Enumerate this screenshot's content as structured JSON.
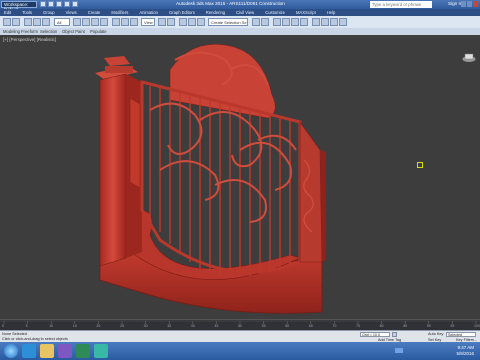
{
  "titlebar": {
    "workspace": "Workspace: Default",
    "title": "Autodesk 3ds Max 2015 - ARS111/D061 Construction",
    "search_placeholder": "Type a keyword or phrase",
    "signin": "Sign In"
  },
  "menu": [
    "Edit",
    "Tools",
    "Group",
    "Views",
    "Create",
    "Modifiers",
    "Animation",
    "Graph Editors",
    "Rendering",
    "Civil View",
    "Customize",
    "MAXScript",
    "Help"
  ],
  "toolbar": {
    "filter_value": "All",
    "view_value": "View",
    "selection_set_value": "Create Selection Se"
  },
  "ribbon": {
    "items": [
      "Modeling",
      "Freeform",
      "Selection",
      "Object Paint",
      "Populate"
    ]
  },
  "viewport": {
    "label": "[+] [Perspective] [Realistic]"
  },
  "timeline": {
    "ticks": [
      "0",
      "5",
      "10",
      "15",
      "20",
      "25",
      "30",
      "35",
      "40",
      "45",
      "50",
      "55",
      "60",
      "65",
      "70",
      "75",
      "80",
      "85",
      "90",
      "95",
      "100"
    ]
  },
  "status": {
    "selection": "None Selected",
    "prompt": "Click or click-and-drag to select objects",
    "grid": "Grid = 10.0",
    "autokey": "Auto Key",
    "setkey": "Set Key",
    "selected": "Selected",
    "keyfilters": "Key Filters...",
    "add_time_tag": "Add Time Tag"
  },
  "taskbar": {
    "time": "9:47 AM",
    "date": "5/9/2016"
  },
  "colors": {
    "titlebar": "#3a68ac",
    "viewport_bg": "#3d3d3d",
    "model": "#c0392b",
    "taskbar": "#3266ac"
  }
}
